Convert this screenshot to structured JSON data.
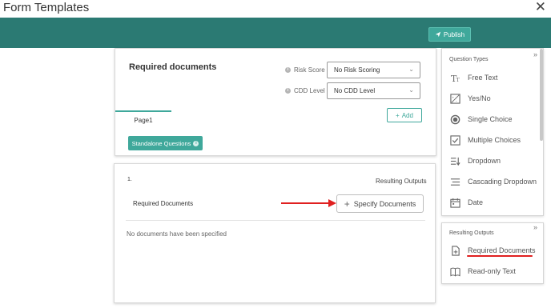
{
  "window": {
    "title": "Form Templates"
  },
  "header": {
    "publish_label": "Publish"
  },
  "form": {
    "title": "Required documents",
    "risk_score": {
      "label": "Risk Score",
      "value": "No Risk Scoring"
    },
    "cdd_level": {
      "label": "CDD Level",
      "value": "No CDD Level"
    },
    "tabs": [
      {
        "label": "Page1"
      }
    ],
    "add_label": "Add",
    "standalone_label": "Standalone Questions"
  },
  "question": {
    "number": "1.",
    "resulting_outputs_label": "Resulting Outputs",
    "name": "Required Documents",
    "specify_label": "Specify Documents",
    "empty_text": "No documents have been specified"
  },
  "question_types": {
    "title": "Question Types",
    "items": [
      {
        "label": "Free Text",
        "icon": "text-format-icon"
      },
      {
        "label": "Yes/No",
        "icon": "yes-no-icon"
      },
      {
        "label": "Single Choice",
        "icon": "radio-icon"
      },
      {
        "label": "Multiple Choices",
        "icon": "checkbox-icon"
      },
      {
        "label": "Dropdown",
        "icon": "dropdown-list-icon"
      },
      {
        "label": "Cascading Dropdown",
        "icon": "cascading-list-icon"
      },
      {
        "label": "Date",
        "icon": "calendar-icon"
      }
    ]
  },
  "resulting_outputs": {
    "title": "Resulting Outputs",
    "items": [
      {
        "label": "Required Documents",
        "icon": "document-icon"
      },
      {
        "label": "Read-only Text",
        "icon": "book-icon"
      }
    ]
  },
  "colors": {
    "teal": "#2b7a73",
    "accent": "#3fa89b",
    "highlight": "#e02020"
  }
}
